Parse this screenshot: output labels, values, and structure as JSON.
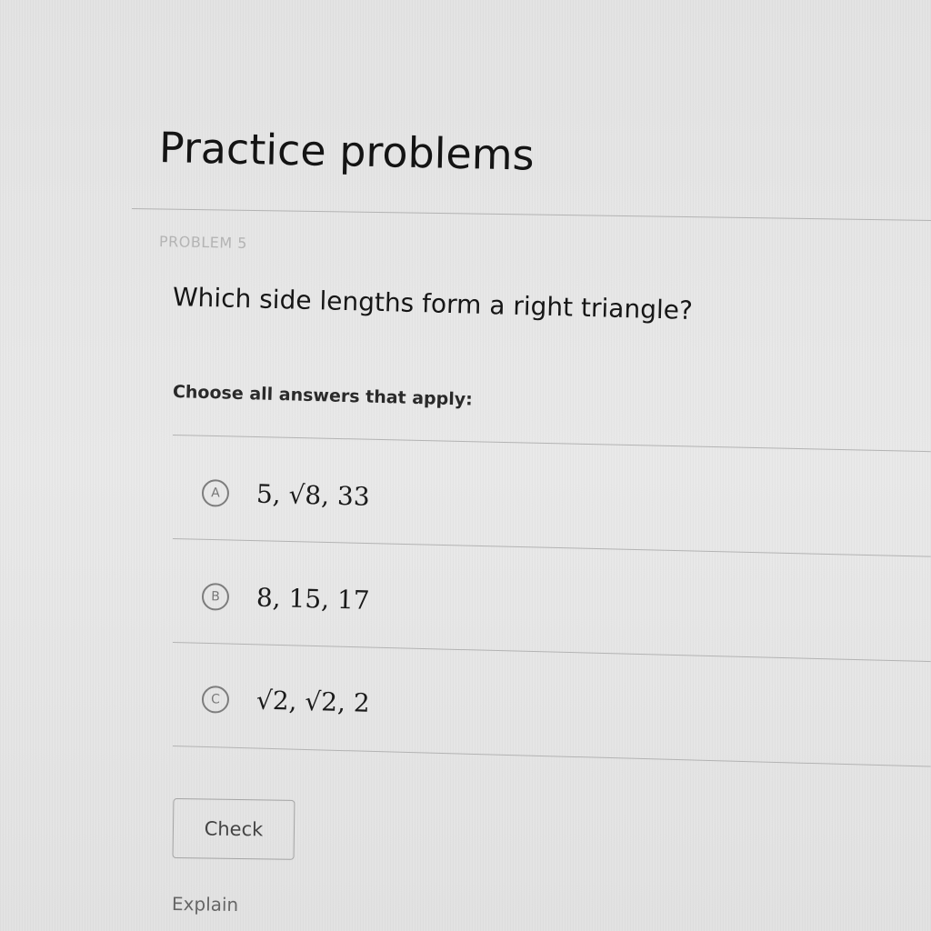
{
  "page": {
    "title": "Practice problems"
  },
  "problem": {
    "label": "PROBLEM 5",
    "question": "Which side lengths form a right triangle?",
    "instructions": "Choose all answers that apply:",
    "choices": [
      {
        "letter": "A",
        "text": "5, √8, 33"
      },
      {
        "letter": "B",
        "text": "8, 15, 17"
      },
      {
        "letter": "C",
        "text": "√2, √2, 2"
      }
    ]
  },
  "actions": {
    "check_label": "Check",
    "explain_label": "Explain"
  }
}
